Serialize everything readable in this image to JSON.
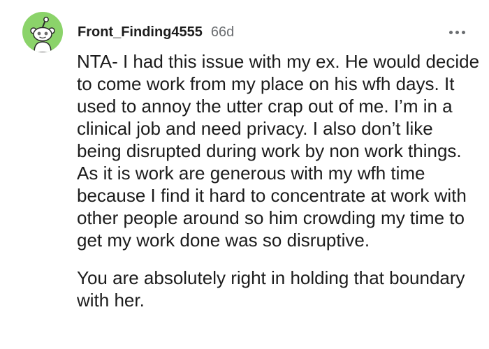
{
  "comment": {
    "author": "Front_Finding4555",
    "age": "66d",
    "avatar_color": "#8bd36a",
    "more_icon": "ellipsis-horizontal-icon",
    "paragraphs": [
      "NTA- I had this issue with my ex. He would decide to come work from my place on his wfh days. It used to annoy the utter crap out of me. I’m in a clinical job and need privacy. I also don’t like being disrupted during work by non work things. As it is work are generous with my wfh time because I find it hard to concentrate at work with other people around so him crowding my time to get my work done was so disruptive.",
      "You are absolutely right in holding that boundary with her."
    ]
  }
}
